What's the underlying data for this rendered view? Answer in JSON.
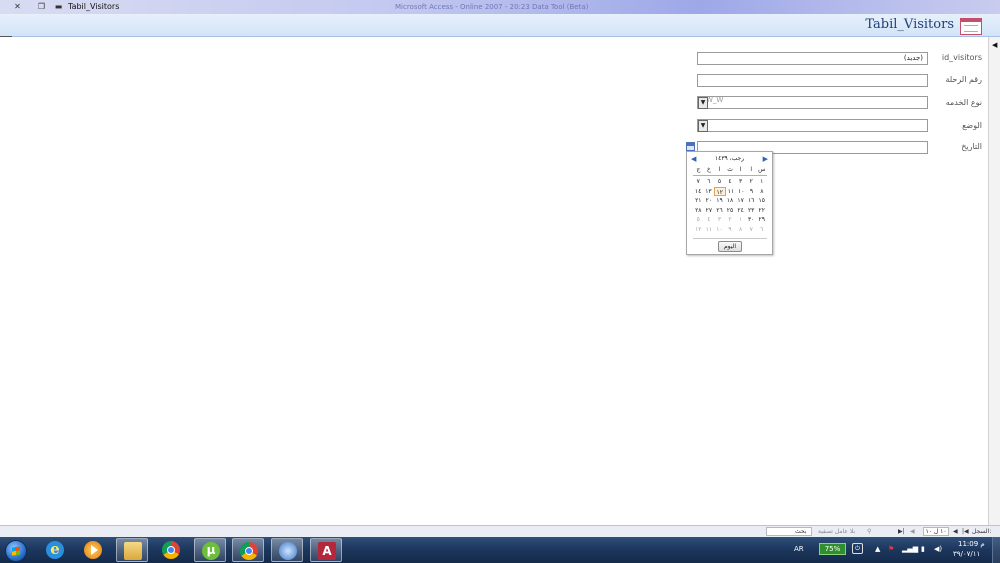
{
  "window": {
    "title": "Tabil_Visitors",
    "app_title": "Microsoft Access - Online 2007 - 20:23 Data Tool (Beta)",
    "close_glyph": "✕",
    "restore_glyph": "❐"
  },
  "form": {
    "title": "Tabil_Visitors",
    "fields": [
      {
        "label": "id_visitors",
        "value": "(جديد)"
      },
      {
        "label": "رقم الرحلة",
        "value": ""
      },
      {
        "label": "نوع الخدمه",
        "value": "",
        "placeholder": "W_W"
      },
      {
        "label": "الوضع",
        "value": ""
      },
      {
        "label": "التاريخ",
        "value": ""
      }
    ]
  },
  "calendar": {
    "title": "رجب، ١٤٣٩",
    "prev_glyph": "◀",
    "next_glyph": "▶",
    "weekdays": [
      "س",
      "ا",
      "ا",
      "ث",
      "ا",
      "خ",
      "ج"
    ],
    "rows": [
      [
        "١",
        "٢",
        "٣",
        "٤",
        "٥",
        "٦",
        "٧"
      ],
      [
        "٨",
        "٩",
        "١٠",
        "١١",
        "١٢",
        "١٣",
        "١٤"
      ],
      [
        "١٥",
        "١٦",
        "١٧",
        "١٨",
        "١٩",
        "٢٠",
        "٢١"
      ],
      [
        "٢٢",
        "٢٣",
        "٢٤",
        "٢٥",
        "٢٦",
        "٢٧",
        "٢٨"
      ],
      [
        "٢٩",
        "٣٠",
        "١",
        "٢",
        "٣",
        "٤",
        "٥"
      ],
      [
        "٦",
        "٧",
        "٨",
        "٩",
        "١٠",
        "١١",
        "١٢"
      ]
    ],
    "today_label": "اليوم"
  },
  "record_nav": {
    "record_label": "السجل:",
    "record_value": "١٠ ل ١٠",
    "filter_label": "بلا عامل تصفية",
    "search_label": "بحث"
  },
  "taskbar": {
    "language": "AR",
    "battery": "75%",
    "time": "11:09 م",
    "date": "٣٩/٠٧/١١"
  },
  "colors": {
    "form_title": "#1f3f76",
    "taskbar": "#1c365c",
    "today_highlight": "#e6a04e"
  }
}
